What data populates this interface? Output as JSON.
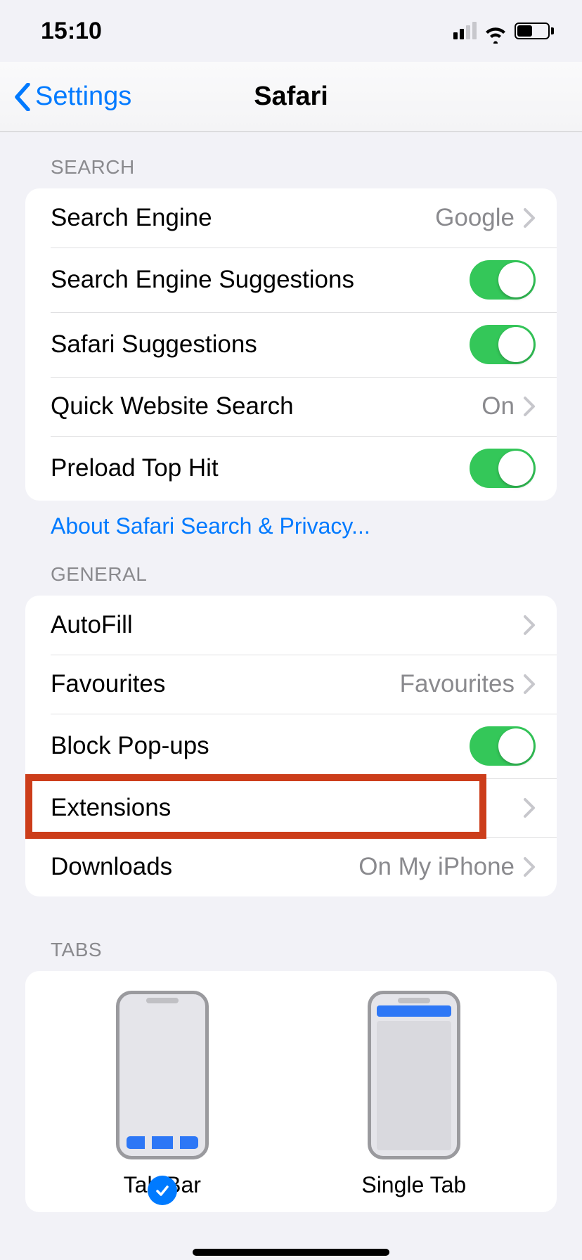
{
  "status": {
    "time": "15:10"
  },
  "nav": {
    "back_label": "Settings",
    "title": "Safari"
  },
  "sections": {
    "search": {
      "header": "SEARCH",
      "search_engine_label": "Search Engine",
      "search_engine_value": "Google",
      "search_suggestions_label": "Search Engine Suggestions",
      "safari_suggestions_label": "Safari Suggestions",
      "quick_website_label": "Quick Website Search",
      "quick_website_value": "On",
      "preload_label": "Preload Top Hit",
      "footer_link": "About Safari Search & Privacy..."
    },
    "general": {
      "header": "GENERAL",
      "autofill_label": "AutoFill",
      "favourites_label": "Favourites",
      "favourites_value": "Favourites",
      "block_popups_label": "Block Pop-ups",
      "extensions_label": "Extensions",
      "downloads_label": "Downloads",
      "downloads_value": "On My iPhone"
    },
    "tabs": {
      "header": "TABS",
      "tabbar_label": "Tab Bar",
      "singletab_label": "Single Tab"
    }
  },
  "toggles": {
    "search_suggestions": true,
    "safari_suggestions": true,
    "preload_top_hit": true,
    "block_popups": true
  }
}
